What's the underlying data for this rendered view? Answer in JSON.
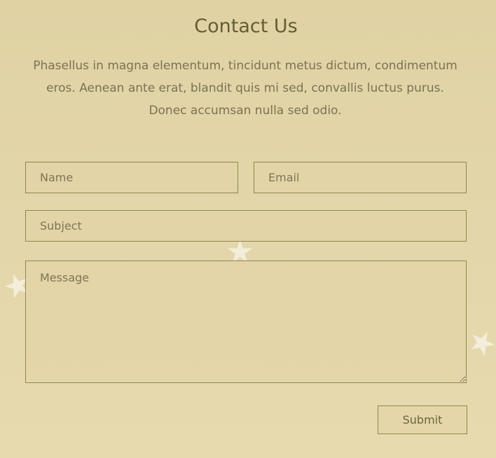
{
  "contacts": {
    "title": "Contact Us",
    "description": "Phasellus in magna elementum, tincidunt metus dictum, condimentum eros. Aenean ante erat, blandit quis mi sed, convallis luctus purus. Donec accumsan nulla sed odio.",
    "form": {
      "name_placeholder": "Name",
      "email_placeholder": "Email",
      "subject_placeholder": "Subject",
      "message_placeholder": "Message",
      "submit_label": "Submit"
    }
  },
  "decorations": {
    "star_icon": "star-icon"
  }
}
